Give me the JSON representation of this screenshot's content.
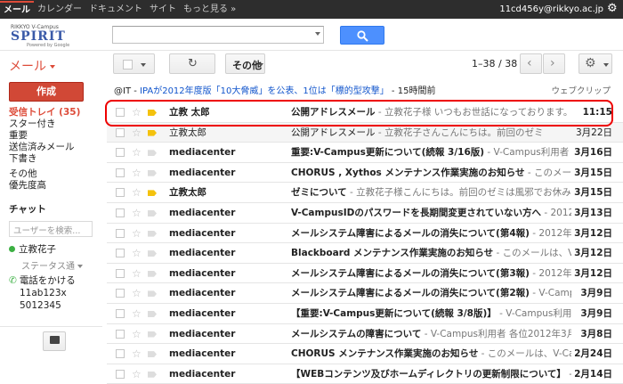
{
  "topbar": {
    "nav": [
      "メール",
      "カレンダー",
      "ドキュメント",
      "サイト",
      "もっと見る »"
    ],
    "user": "11cd456y@rikkyo.ac.jp",
    "settings_icon": "gear-icon"
  },
  "logo": {
    "small": "RIKKYO V-Campus",
    "big": "SPIRIT",
    "powered": "Powered by Google"
  },
  "search": {
    "value": "",
    "button_icon": "search-icon",
    "accent": "#4d90fe"
  },
  "toolbar": {
    "mail_label": "メール",
    "more_label": "その他",
    "pager": "1–38 / 38",
    "refresh_icon": "refresh-icon",
    "prev_icon": "chevron-left-icon",
    "next_icon": "chevron-right-icon"
  },
  "compose": {
    "label": "作成",
    "color": "#d14836"
  },
  "sidebar": {
    "items": [
      "受信トレイ (35)",
      "スター付き",
      "重要",
      "送信済みメール",
      "下書き",
      "その他",
      "優先度高"
    ]
  },
  "chat": {
    "title": "チャット",
    "search_placeholder": "ユーザーを検索...",
    "user": "立教花子",
    "status": "ステータス通",
    "call": "電話をかける",
    "numbers": [
      "11ab123x",
      "5012345"
    ]
  },
  "ad": {
    "source": "@IT - ",
    "text": "IPAが2012年度版「10大脅威」を公表、1位は「標的型攻撃」",
    "when": " - 15時間前",
    "clip": "ウェブクリップ"
  },
  "messages": [
    {
      "sender": "立教 太郎",
      "subject": "公開アドレスメール",
      "snippet": " - 立教花子様 いつもお世話になっております。立教",
      "date": "11:15",
      "unread": true,
      "important": true
    },
    {
      "sender": "立教太郎",
      "subject": "公開アドレスメール",
      "snippet": " - 立教花子さんこんにちは。前回のゼミ",
      "date": "3月22日",
      "unread": false,
      "important": true
    },
    {
      "sender": "mediacenter",
      "subject": "重要:V-Campus更新について(続報 3/16版)",
      "snippet": " - V-Campus利用者 各",
      "date": "3月16日",
      "unread": true,
      "important": false
    },
    {
      "sender": "mediacenter",
      "subject": "CHORUS , Xythos メンテナンス作業実施のお知らせ",
      "snippet": " - このメールは",
      "date": "3月15日",
      "unread": true,
      "important": false
    },
    {
      "sender": "立教太郎",
      "subject": "ゼミについて",
      "snippet": " - 立教花子様こんにちは。前回のゼミは風邪でお休みし",
      "date": "3月15日",
      "unread": true,
      "important": true
    },
    {
      "sender": "mediacenter",
      "subject": "V-CampusIDのパスワードを長期間変更されていない方へ",
      "snippet": " - 2012年",
      "date": "3月13日",
      "unread": true,
      "important": false
    },
    {
      "sender": "mediacenter",
      "subject": "メールシステム障害によるメールの消失について(第4報)",
      "snippet": " - 2012年3",
      "date": "3月12日",
      "unread": true,
      "important": false
    },
    {
      "sender": "mediacenter",
      "subject": "Blackboard メンテナンス作業実施のお知らせ",
      "snippet": " - このメールは、V-Ca",
      "date": "3月12日",
      "unread": true,
      "important": false
    },
    {
      "sender": "mediacenter",
      "subject": "メールシステム障害によるメールの消失について(第3報)",
      "snippet": " - 2012年3",
      "date": "3月12日",
      "unread": true,
      "important": false
    },
    {
      "sender": "mediacenter",
      "subject": "メールシステム障害によるメールの消失について(第2報)",
      "snippet": " - V-Campus利用",
      "date": "3月9日",
      "unread": true,
      "important": false
    },
    {
      "sender": "mediacenter",
      "subject": "【重要:V-Campus更新について(続報 3/8版)】",
      "snippet": " - V-Campus利用者 各",
      "date": "3月9日",
      "unread": true,
      "important": false
    },
    {
      "sender": "mediacenter",
      "subject": "メールシステムの障害について",
      "snippet": " - V-Campus利用者 各位2012年3月8日",
      "date": "3月8日",
      "unread": true,
      "important": false
    },
    {
      "sender": "mediacenter",
      "subject": "CHORUS メンテナンス作業実施のお知らせ",
      "snippet": " - このメールは、V-Campus",
      "date": "2月24日",
      "unread": true,
      "important": false
    },
    {
      "sender": "mediacenter",
      "subject": "【WEBコンテンツ及びホームディレクトリの更新制限について】",
      "snippet": " - V-Campus",
      "date": "2月14日",
      "unread": true,
      "important": false
    }
  ]
}
